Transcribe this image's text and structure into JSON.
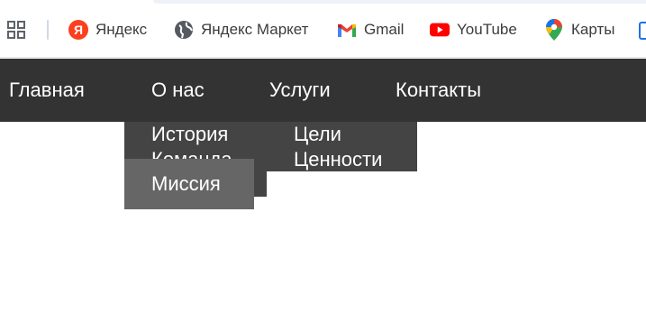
{
  "bookmarks": {
    "items": [
      {
        "label": "Яндекс",
        "icon": "yandex-icon"
      },
      {
        "label": "Яндекс Маркет",
        "icon": "globe-icon"
      },
      {
        "label": "Gmail",
        "icon": "gmail-icon"
      },
      {
        "label": "YouTube",
        "icon": "youtube-icon"
      },
      {
        "label": "Карты",
        "icon": "maps-pin-icon"
      }
    ]
  },
  "nav": {
    "items": [
      {
        "label": "Главная"
      },
      {
        "label": "О нас"
      },
      {
        "label": "Услуги"
      },
      {
        "label": "Контакты"
      }
    ],
    "about_dropdown": {
      "items": [
        "История",
        "Команда",
        "Миссия"
      ],
      "hovered": "Миссия"
    },
    "services_dropdown": {
      "items": [
        "Цели",
        "Ценности"
      ]
    }
  },
  "colors": {
    "nav_bg": "#333333",
    "dropdown_bg": "#444444",
    "dropdown_hover_bg": "#666666",
    "nav_text": "#ffffff"
  }
}
